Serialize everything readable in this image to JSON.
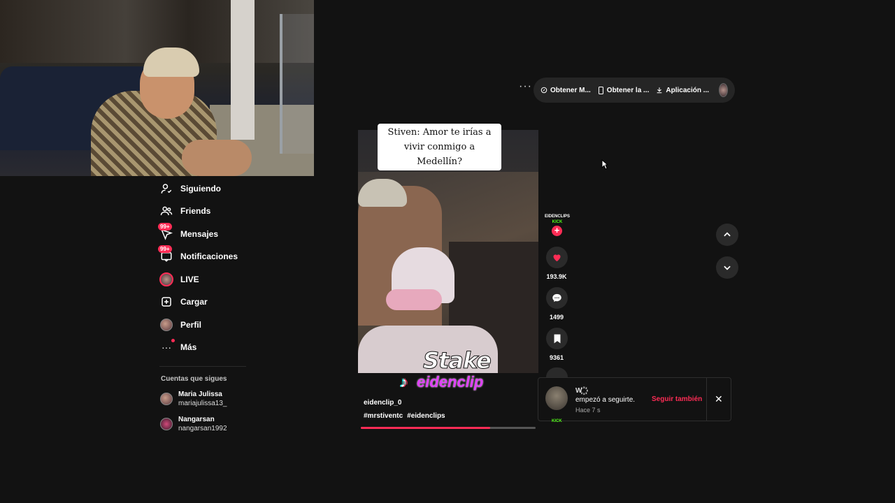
{
  "sidebar": {
    "items": [
      {
        "label": "Siguiendo",
        "icon": "following-icon"
      },
      {
        "label": "Friends",
        "icon": "friends-icon"
      },
      {
        "label": "Mensajes",
        "icon": "messages-icon",
        "badge": "99+"
      },
      {
        "label": "Notificaciones",
        "icon": "notifications-icon",
        "badge": "99+"
      },
      {
        "label": "LIVE",
        "icon": "live-icon"
      },
      {
        "label": "Cargar",
        "icon": "upload-icon"
      },
      {
        "label": "Perfil",
        "icon": "profile-avatar"
      },
      {
        "label": "Más",
        "icon": "more-icon"
      }
    ],
    "following_title": "Cuentas que sigues",
    "accounts": [
      {
        "name": "Maria Julissa",
        "username": "mariajulissa13_"
      },
      {
        "name": "Nangarsan",
        "username": "nangarsan1992"
      }
    ]
  },
  "toolbar": {
    "more": "···",
    "get_coins": "Obtener M...",
    "get_app": "Obtener la ...",
    "desktop_app": "Aplicación ..."
  },
  "video": {
    "caption": "Stiven: Amor te irías a vivir conmigo a Medellín?",
    "sponsor": "Stake",
    "watermark": "eidenclip",
    "author": "eidenclip_0",
    "hashtags": [
      "#mrstiventc",
      "#eidenclips"
    ],
    "progress": 0.74
  },
  "actions": {
    "author_badge_line1": "EIDENCLIPS",
    "author_badge_line2": "KICK",
    "likes": "193.9K",
    "comments": "1499",
    "saves": "9361"
  },
  "notification": {
    "name": "W ꙰",
    "message": "empezó a seguirte.",
    "time": "Hace 7 s",
    "follow_back": "Seguir también",
    "kick_peek": "KICK"
  },
  "colors": {
    "background": "#121212",
    "accent": "#fe2c55",
    "kick_green": "#53fc18"
  }
}
